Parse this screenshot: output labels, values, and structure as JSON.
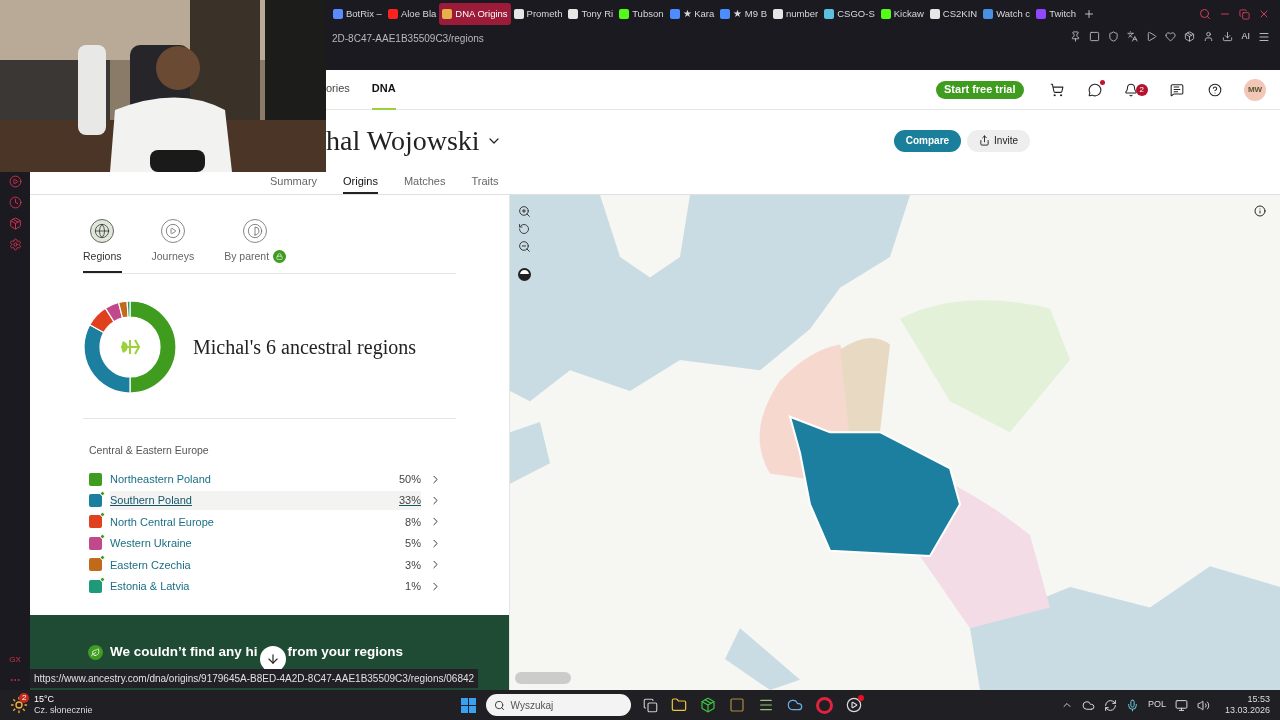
{
  "browser": {
    "tabs": [
      {
        "title": "BotRix –",
        "color": "#5a8cff",
        "selected": false
      },
      {
        "title": "Aloe Bla",
        "color": "#ff2020",
        "selected": false
      },
      {
        "title": "DNA Origins",
        "color": "#e8b04a",
        "selected": true
      },
      {
        "title": "Prometh",
        "color": "#e6e6e6",
        "selected": false
      },
      {
        "title": "Tony Ri",
        "color": "#e6e6e6",
        "selected": false
      },
      {
        "title": "Tubson",
        "color": "#53fc18",
        "selected": false
      },
      {
        "title": "★ Kara",
        "color": "#4c8dff",
        "selected": false
      },
      {
        "title": "★ M9 B",
        "color": "#4c8dff",
        "selected": false
      },
      {
        "title": "number",
        "color": "#e6e6e6",
        "selected": false
      },
      {
        "title": "CSGO-S",
        "color": "#5bc0de",
        "selected": false
      },
      {
        "title": "Kickaw",
        "color": "#53fc18",
        "selected": false
      },
      {
        "title": "CS2KIN",
        "color": "#e6e6e6",
        "selected": false
      },
      {
        "title": "Watch c",
        "color": "#4a90e2",
        "selected": false
      },
      {
        "title": "Twitch",
        "color": "#9146ff",
        "selected": false
      }
    ],
    "address": "2D-8C47-AAE1B35509C3/regions",
    "sidebar_logo": "GX",
    "ai_label": "AI",
    "status_url": "https://www.ancestry.com/dna/origins/9179645A-B8ED-4A2D-8C47-AAE1B35509C3/regions/06842"
  },
  "nav": {
    "items": [
      {
        "label": "ories",
        "selected": false
      },
      {
        "label": "DNA",
        "selected": true
      }
    ],
    "trial_button": "Start free trial",
    "notification_count": "2",
    "avatar": "MW"
  },
  "header": {
    "name": "hal Wojowski",
    "compare": "Compare",
    "invite": "Invite",
    "tabs": [
      {
        "label": "Summary",
        "selected": false
      },
      {
        "label": "Origins",
        "selected": true
      },
      {
        "label": "Matches",
        "selected": false
      },
      {
        "label": "Traits",
        "selected": false
      }
    ]
  },
  "panel": {
    "view_tabs": [
      {
        "label": "Regions",
        "selected": true,
        "locked": false
      },
      {
        "label": "Journeys",
        "selected": false,
        "locked": false
      },
      {
        "label": "By parent",
        "selected": false,
        "locked": true
      }
    ],
    "title": "Michal's 6 ancestral regions",
    "chart_data": {
      "type": "donut",
      "values": [
        50,
        33,
        8,
        5,
        3,
        1
      ]
    },
    "group": "Central & Eastern Europe",
    "regions": [
      {
        "name": "Northeastern Poland",
        "percent": "50%",
        "color": "#3f9c1f",
        "new": false,
        "highlighted": false
      },
      {
        "name": "Southern Poland",
        "percent": "33%",
        "color": "#1d7fa0",
        "new": true,
        "highlighted": true
      },
      {
        "name": "North Central Europe",
        "percent": "8%",
        "color": "#e0401e",
        "new": true,
        "highlighted": false
      },
      {
        "name": "Western Ukraine",
        "percent": "5%",
        "color": "#c1488a",
        "new": true,
        "highlighted": false
      },
      {
        "name": "Eastern Czechia",
        "percent": "3%",
        "color": "#c06a1a",
        "new": true,
        "highlighted": false
      },
      {
        "name": "Estonia & Latvia",
        "percent": "1%",
        "color": "#1e9a78",
        "new": true,
        "highlighted": false
      }
    ],
    "banner": {
      "text_start": "We couldn’t find any hi",
      "text_end": "from your regions"
    }
  },
  "taskbar": {
    "weather_badge": "2",
    "temperature": "15°C",
    "weather": "Cz. słonecznie",
    "search_placeholder": "Wyszukaj",
    "language": "POL",
    "time": "15:53",
    "date": "13.03.2026"
  }
}
